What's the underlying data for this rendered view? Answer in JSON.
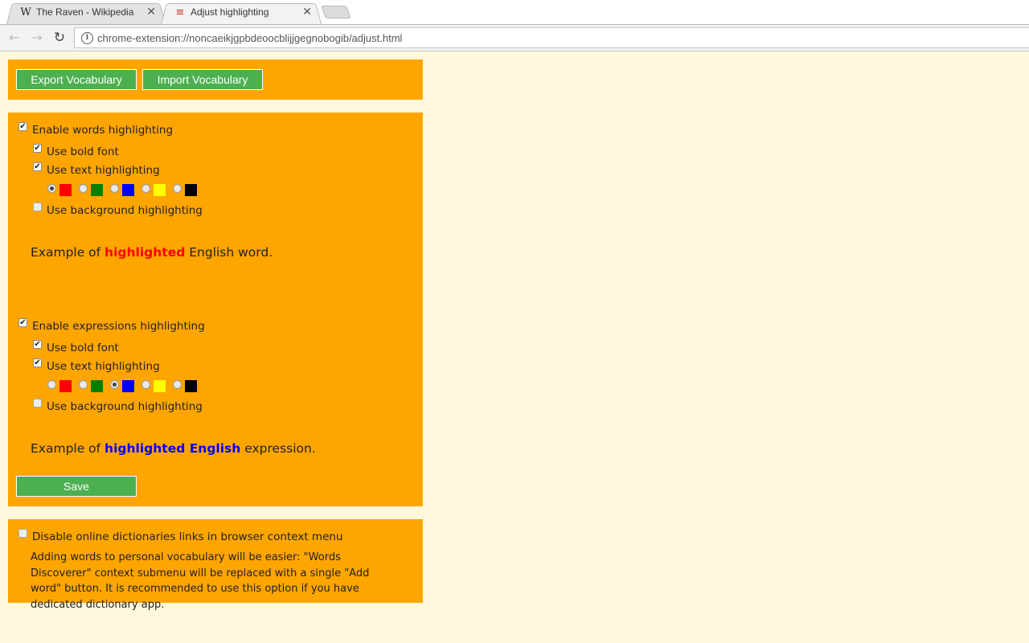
{
  "browser": {
    "tabs": [
      {
        "title": "The Raven - Wikipedia",
        "favicon": "W"
      },
      {
        "title": "Adjust highlighting",
        "favicon": "≡"
      }
    ],
    "close_glyph": "✕",
    "address": "chrome-extension://noncaeikjgpbdeoocblijjgegnobogib/adjust.html"
  },
  "vocab": {
    "export_label": "Export Vocabulary",
    "import_label": "Import Vocabulary"
  },
  "words": {
    "enable_label": "Enable words highlighting",
    "bold_label": "Use bold font",
    "text_label": "Use text highlighting",
    "bg_label": "Use background highlighting",
    "enabled": true,
    "bold": true,
    "text": true,
    "bg": false,
    "selected_color": 0,
    "example_prefix": "Example of ",
    "example_highlight": "highlighted",
    "example_suffix": " English word.",
    "highlight_color": "#ff0000"
  },
  "expressions": {
    "enable_label": "Enable expressions highlighting",
    "bold_label": "Use bold font",
    "text_label": "Use text highlighting",
    "bg_label": "Use background highlighting",
    "enabled": true,
    "bold": true,
    "text": true,
    "bg": false,
    "selected_color": 2,
    "example_prefix": "Example of ",
    "example_highlight": "highlighted English",
    "example_suffix": " expression.",
    "highlight_color": "#0000ff"
  },
  "swatch_colors": [
    "#ff0000",
    "#008000",
    "#0000ff",
    "#ffff00",
    "#000000"
  ],
  "save_label": "Save",
  "context_menu": {
    "disable_label": "Disable online dictionaries links in browser context menu",
    "disabled": false,
    "description": "Adding words to personal vocabulary will be easier: \"Words Discoverer\" context submenu will be replaced with a single \"Add word\" button. It is recommended to use this option if you have dedicated dictionary app."
  },
  "colors": {
    "panel": "#ffa500",
    "button": "#4caf50",
    "page_bg": "#fff8dc"
  }
}
